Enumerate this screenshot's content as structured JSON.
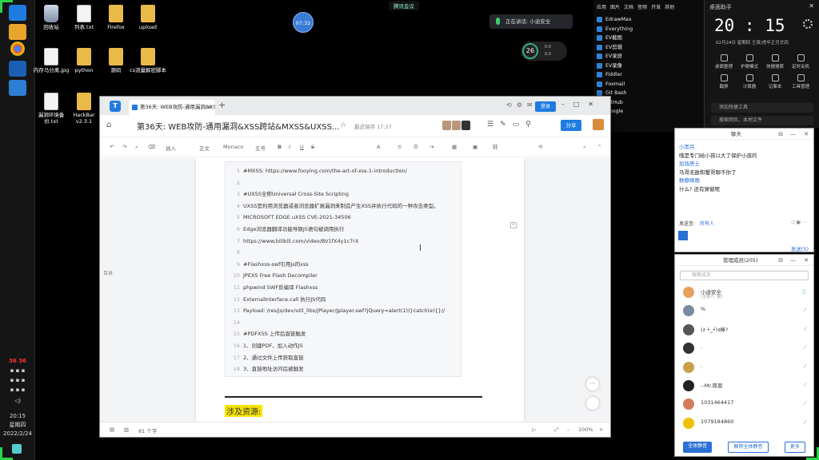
{
  "desktop": {
    "icons": [
      {
        "label": "回收站",
        "kind": "bin"
      },
      {
        "label": "列表.txt",
        "kind": "doc"
      },
      {
        "label": "Firefox",
        "kind": "folder"
      },
      {
        "label": "upload",
        "kind": "folder"
      },
      {
        "label": "内存马分离.jpg",
        "kind": "doc"
      },
      {
        "label": "python",
        "kind": "folder"
      },
      {
        "label": "源码",
        "kind": "folder"
      },
      {
        "label": "cs流量解密脚本",
        "kind": "folder"
      },
      {
        "label": "漏洞环境备份.txt",
        "kind": "doc"
      },
      {
        "label": "HackBar v2.3.1",
        "kind": "folder"
      }
    ]
  },
  "meeting": {
    "top_label": "腾讯会议",
    "timer": "07:32",
    "speaking": "正在讲话: 小迪安全"
  },
  "netmon": {
    "percent": "26",
    "up": "0.0",
    "down": "0.0"
  },
  "taskbar": {
    "tray1": "36 36",
    "clock_time": "20:15",
    "clock_day": "星期四",
    "clock_date": "2022/2/24"
  },
  "right_panel": {
    "tabs": [
      "应用",
      "图片",
      "文档",
      "音频",
      "开发",
      "其他"
    ],
    "items": [
      "EdrawMax",
      "Everything",
      "EV截图",
      "EV剪辑",
      "EV录屏",
      "EV录像",
      "Fiddler",
      "Foxmail",
      "Git Bash",
      "GitHub",
      "Google"
    ]
  },
  "assistant": {
    "title": "桌面助手",
    "time": "20 : 15",
    "date": "02月24日  星期四  壬寅/虎年正月廿四",
    "tools": [
      "桌面整理",
      "护眼模式",
      "快捷搜索",
      "定时关机",
      "截屏",
      "计算器",
      "记事本",
      "工具管理"
    ],
    "add_tool": "添加快捷工具",
    "search_placeholder": "搜索网页、本地文件"
  },
  "chat": {
    "title": "聊天",
    "messages": [
      {
        "name": "小黑兵",
        "text": "哦是专门给小孩以大了保护小孩的"
      },
      {
        "name": "加钱居士",
        "text": "马哥无敌和蟹哥聊不你了"
      },
      {
        "name": "静静晚晚",
        "text": "什么? 还有弹窗呢"
      }
    ],
    "recipient_label": "发送至:",
    "recipient_value": "所有人",
    "send": "发送(S)"
  },
  "members": {
    "title": "管理成员(205)",
    "search_placeholder": "搜索成员",
    "list": [
      {
        "name": "小迪安全",
        "sub": "(主持人, 我)",
        "color": "#e6a060"
      },
      {
        "name": "%",
        "sub": "",
        "color": "#7a8aa0"
      },
      {
        "name": "(ง •̀_•́)ง棒?",
        "sub": "",
        "color": "#555"
      },
      {
        "name": ".",
        "sub": "",
        "color": "#333"
      },
      {
        "name": ".",
        "sub": "",
        "color": "#c9a04a"
      },
      {
        "name": "--Mr.周恩",
        "sub": "",
        "color": "#222"
      },
      {
        "name": "1031464417",
        "sub": "",
        "color": "#d47b5a"
      },
      {
        "name": "1079184860",
        "sub": "",
        "color": "#f0c000"
      }
    ],
    "btn_mute_all": "全体静音",
    "btn_unmute_all": "解除全体静音",
    "btn_more": "更多"
  },
  "doc": {
    "tab_label": "第36天: WEB攻防-通用漏洞&XSS跨站&MXSS&UXSS&FlashXSS&PDFXSS",
    "login": "登录",
    "title": "第36天: WEB攻防-通用漏洞&XSS跨站&MXSS&UXSS...",
    "saved": "最近保存 17:37",
    "share": "分享",
    "toolbar": [
      "插入",
      "正文",
      "Monaco",
      "五号"
    ],
    "outline": "目录",
    "code_lines": [
      {
        "n": "1",
        "t": "#MXSS: https://www.fooying.com/the-art-of-xss-1-introduction/"
      },
      {
        "n": "2",
        "t": ""
      },
      {
        "n": "3",
        "t": "#UXSS全称Universal Cross-Site Scripting"
      },
      {
        "n": "4",
        "t": "UXSS是利用浏览器或者浏览器扩展漏洞来制造产生XSS并执行代码的一种攻击类型。"
      },
      {
        "n": "5",
        "t": "MICROSOFT EDGE uXSS CVE-2021-34506"
      },
      {
        "n": "6",
        "t": "Edge浏览器翻译功能导致JS语句被调用执行"
      },
      {
        "n": "7",
        "t": "https://www.bilibili.com/video/BV1fX4y1c7rX"
      },
      {
        "n": "8",
        "t": ""
      },
      {
        "n": "9",
        "t": "#Flashxss-swf引用js的xss"
      },
      {
        "n": "10",
        "t": "JPEXS Free Flash Decompiler"
      },
      {
        "n": "11",
        "t": "phpwind SWF反编译 Flashxss"
      },
      {
        "n": "12",
        "t": "ExternalInterface.call 执行JS代码"
      },
      {
        "n": "13",
        "t": "Payload: /res/js/dev/util_libs/jPlayer/Jplayer.swf?jQuery=alert(1))}catch(e){}//"
      },
      {
        "n": "14",
        "t": ""
      },
      {
        "n": "15",
        "t": "#PDFXSS 上传后直链触发"
      },
      {
        "n": "16",
        "t": "1、创建PDF，加入动作JS"
      },
      {
        "n": "17",
        "t": "2、通过文件上传获取直链"
      },
      {
        "n": "18",
        "t": "3、直链地址访问后被触发"
      }
    ],
    "highlight": "涉及资源:",
    "word_count": "81 个字",
    "zoom": "100%"
  }
}
